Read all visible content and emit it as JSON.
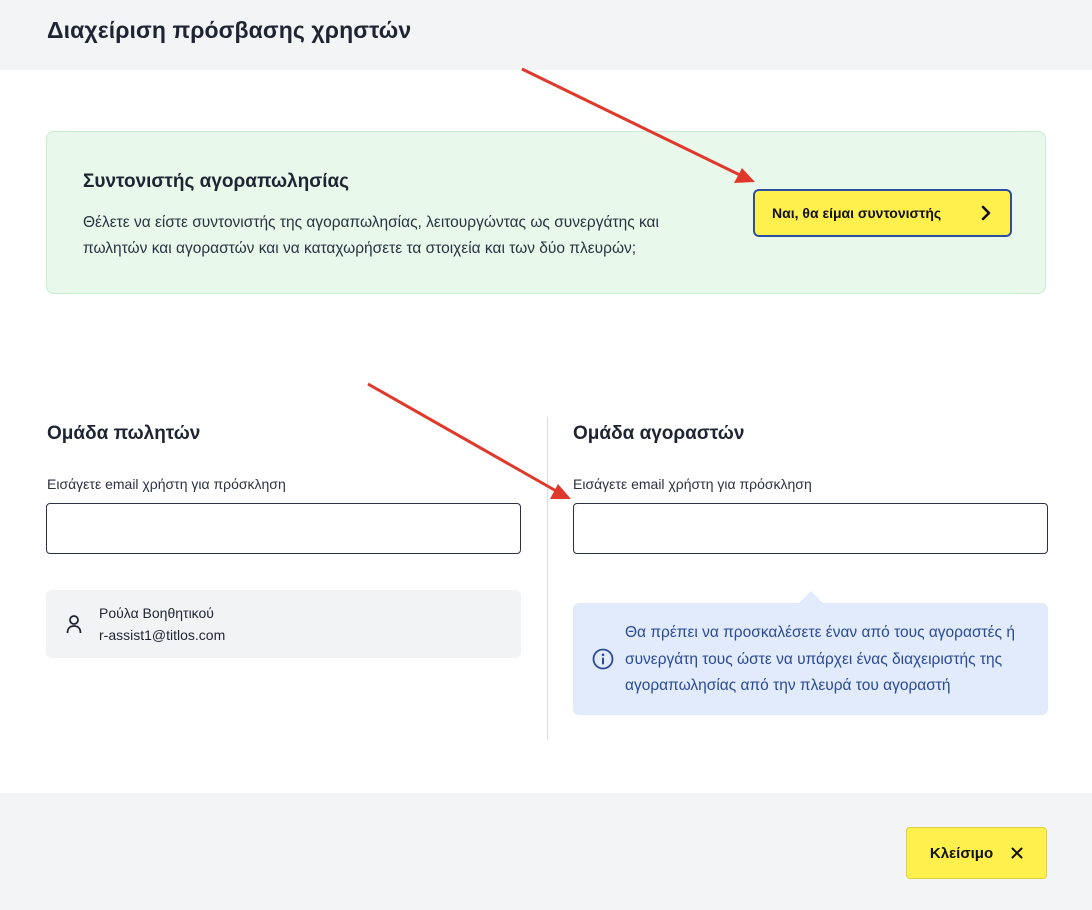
{
  "page": {
    "title": "Διαχείριση πρόσβασης χρηστών"
  },
  "coordinator": {
    "title": "Συντονιστής αγοραπωλησίας",
    "description": "Θέλετε να είστε συντονιστής της αγοραπωλησίας, λειτουργώντας ως συνεργάτης και πωλητών και αγοραστών και να καταχωρήσετε τα στοιχεία και των δύο πλευρών;",
    "button_label": "Ναι, θα είμαι συντονιστής",
    "button_icon": "chevron-right-icon"
  },
  "sellers": {
    "title": "Ομάδα πωλητών",
    "email_label": "Εισάγετε email χρήστη για πρόσκληση",
    "email_value": "",
    "members": [
      {
        "name": "Ρούλα Βοηθητικού",
        "email": "r-assist1@titlos.com",
        "icon": "person-icon"
      }
    ]
  },
  "buyers": {
    "title": "Ομάδα αγοραστών",
    "email_label": "Εισάγετε email χρήστη για πρόσκληση",
    "email_value": "",
    "info_icon": "info-icon",
    "info_text": "Θα πρέπει να προσκαλέσετε έναν από τους αγοραστές ή συνεργάτη τους ώστε να υπάρχει ένας διαχειριστής της αγοραπωλησίας από την πλευρά του αγοραστή"
  },
  "footer": {
    "close_label": "Κλείσιμο",
    "close_icon": "close-icon"
  },
  "colors": {
    "accent_yellow": "#fff04d",
    "annotation_red": "#e0392b",
    "info_blue": "#2a4a94",
    "success_bg": "#e8f9ec"
  }
}
